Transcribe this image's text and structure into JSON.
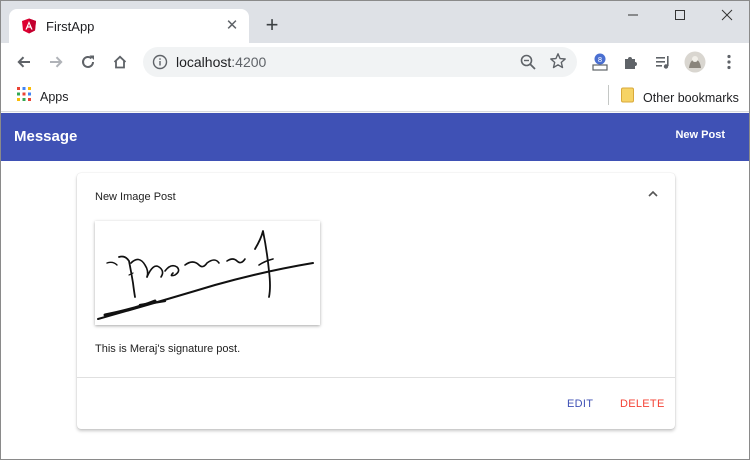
{
  "browser": {
    "tab": {
      "title": "FirstApp"
    },
    "address": {
      "host": "localhost",
      "port": ":4200"
    },
    "bookmarks": {
      "apps_label": "Apps",
      "other_label": "Other bookmarks"
    }
  },
  "app": {
    "brand": "Message",
    "nav": {
      "new_post_label": "New Post"
    },
    "post": {
      "title": "New Image Post",
      "body": "This is Meraj's signature post.",
      "edit_label": "EDIT",
      "delete_label": "DELETE"
    }
  },
  "colors": {
    "primary": "#3f51b5",
    "warn": "#f44336",
    "tabstrip": "#dee1e6",
    "angular": "#dd0031"
  }
}
